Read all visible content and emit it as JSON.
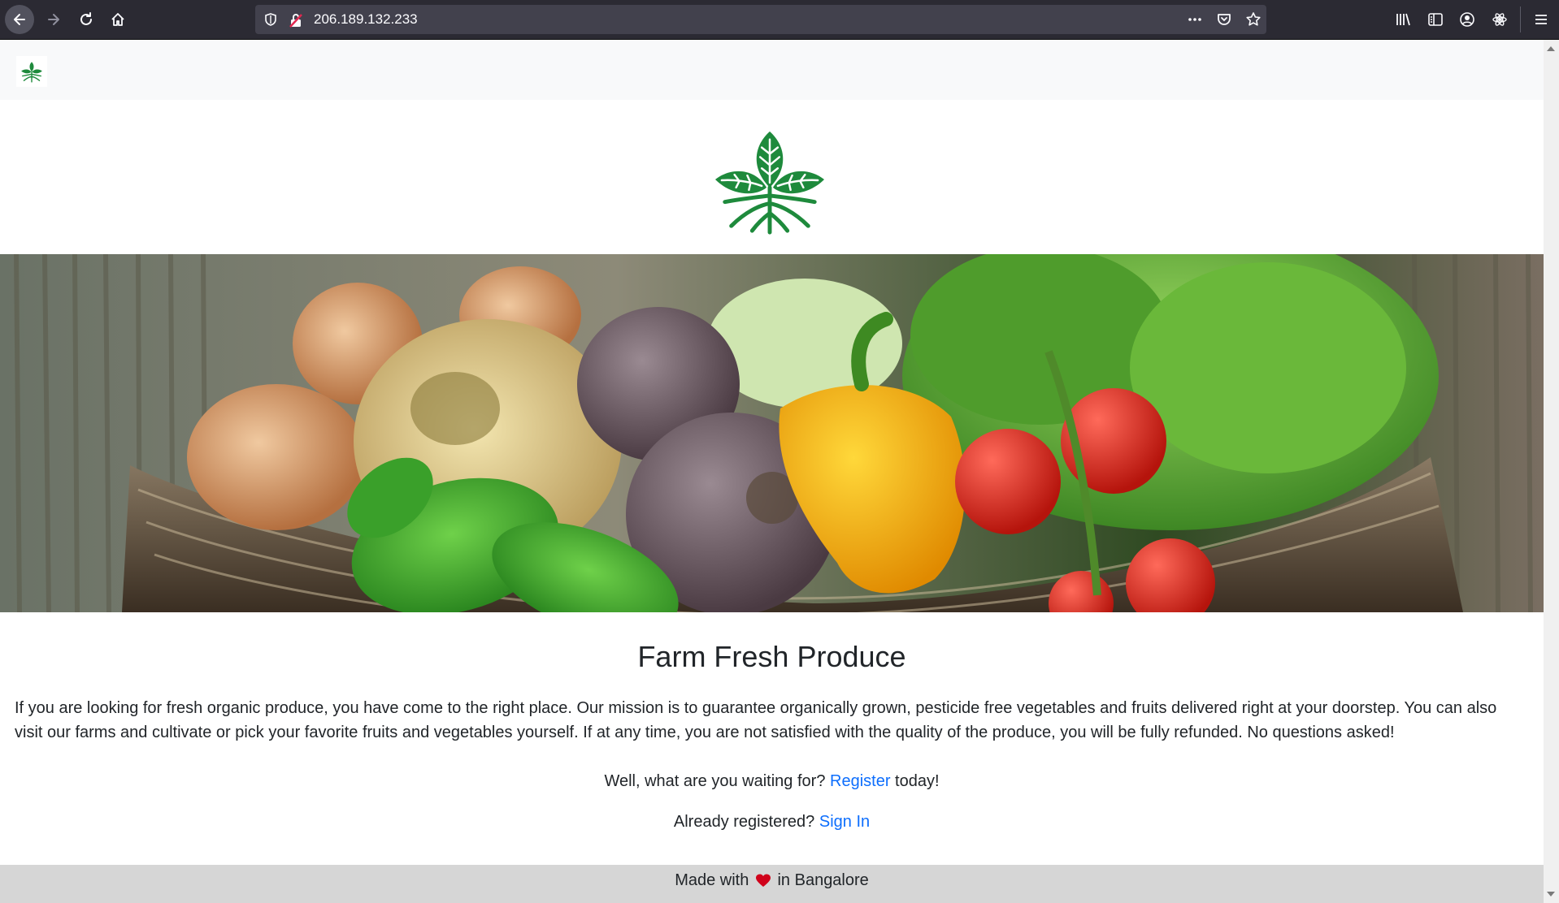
{
  "browser": {
    "url": "206.189.132.233",
    "icons": [
      "back-arrow-icon",
      "forward-arrow-icon",
      "reload-icon",
      "home-icon",
      "tracking-shield-icon",
      "insecure-lock-icon",
      "more-actions-icon",
      "pocket-icon",
      "bookmark-star-icon",
      "library-icon",
      "sidebar-icon",
      "account-icon",
      "extension-icon",
      "menu-icon"
    ]
  },
  "hero": {
    "image": "vegetable-basket-photo"
  },
  "main": {
    "title": "Farm Fresh Produce",
    "description": "If you are looking for fresh organic produce, you have come to the right place. Our mission is to guarantee organically grown, pesticide free vegetables and fruits delivered right at your doorstep. You can also visit our farms and cultivate or pick your favorite fruits and vegetables yourself. If at any time, you are not satisfied with the quality of the produce, you will be fully refunded. No questions asked!",
    "register_prompt": "Well, what are you waiting for? ",
    "register_link": "Register",
    "register_suffix": " today!",
    "signin_prompt": "Already registered? ",
    "signin_link": "Sign In"
  },
  "footer": {
    "prefix": "Made with ",
    "suffix": " in Bangalore"
  },
  "colors": {
    "brand_green": "#1e8a3c",
    "link": "#0d6efd",
    "footer_bg": "#d6d6d6",
    "navbar_bg": "#f8f9fa"
  }
}
